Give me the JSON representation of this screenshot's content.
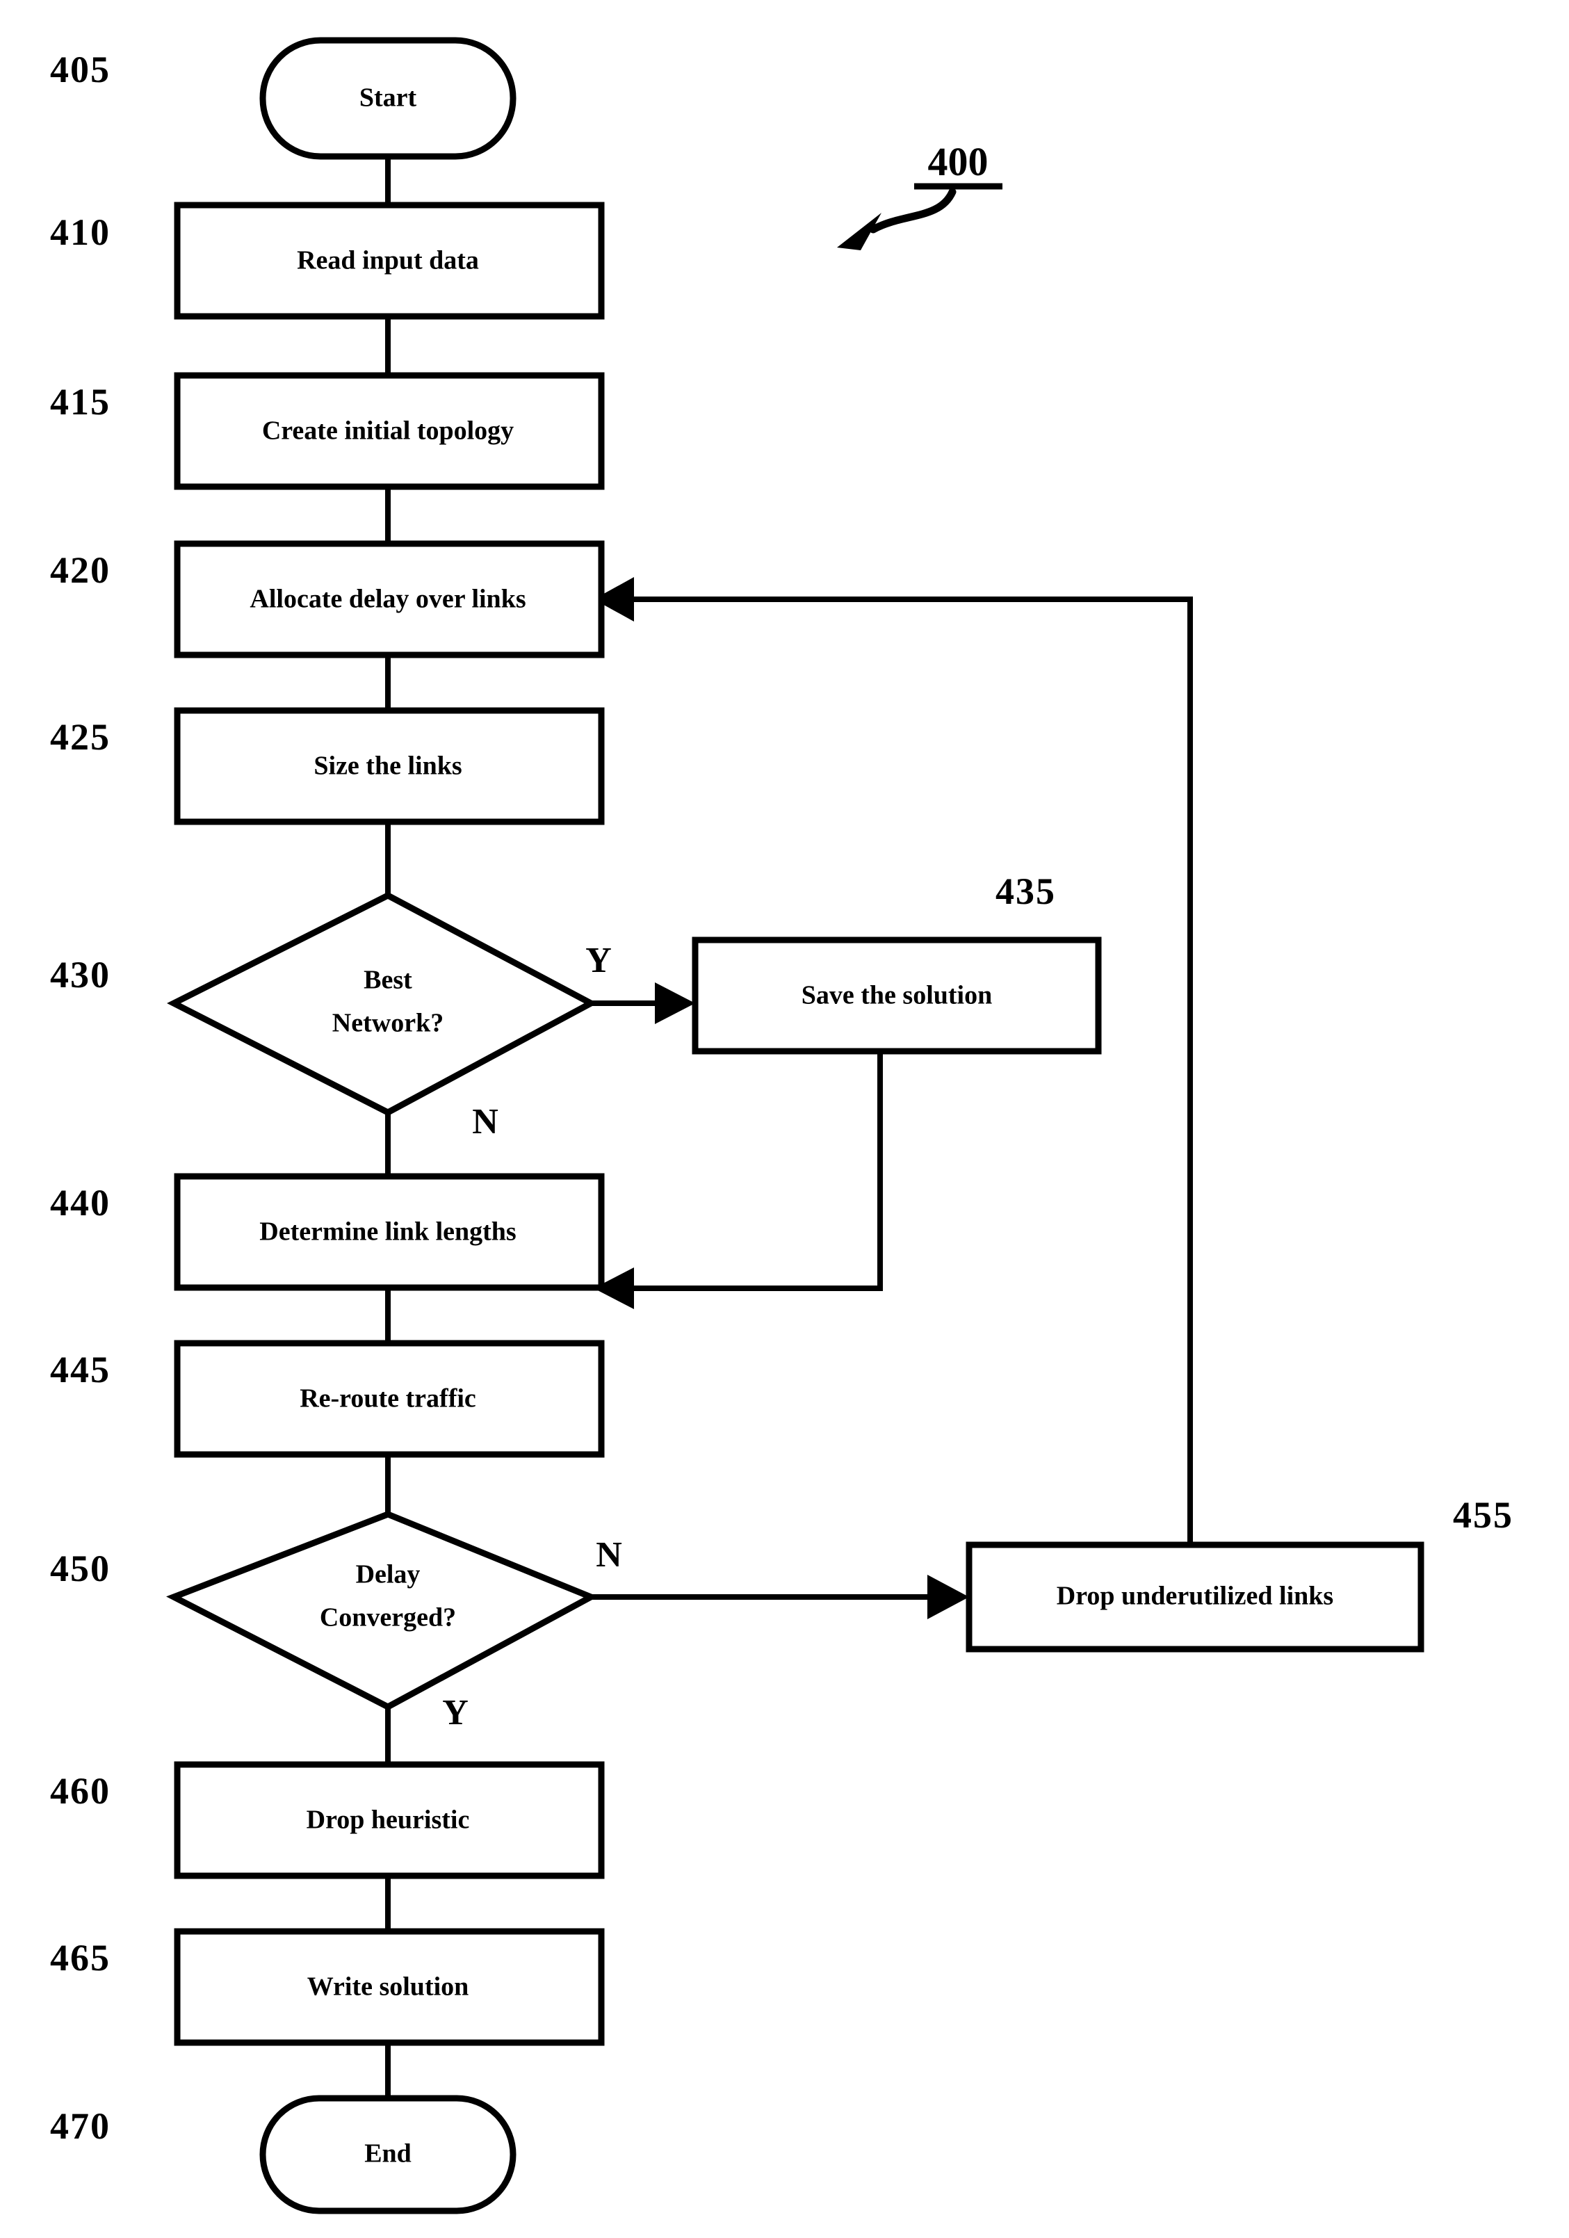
{
  "figure": {
    "number": "400",
    "title_ref": "400"
  },
  "nodes": [
    {
      "id": "start",
      "ref": "405",
      "label": "Start",
      "shape": "terminal"
    },
    {
      "id": "read",
      "ref": "410",
      "label": "Read input data",
      "shape": "process"
    },
    {
      "id": "topo",
      "ref": "415",
      "label": "Create initial topology",
      "shape": "process"
    },
    {
      "id": "alloc",
      "ref": "420",
      "label": "Allocate delay over links",
      "shape": "process"
    },
    {
      "id": "size",
      "ref": "425",
      "label": "Size the links",
      "shape": "process"
    },
    {
      "id": "best",
      "ref": "430",
      "label": "Best Network?",
      "shape": "decision",
      "line1": "Best",
      "line2": "Network?"
    },
    {
      "id": "save",
      "ref": "435",
      "label": "Save the solution",
      "shape": "process"
    },
    {
      "id": "lengths",
      "ref": "440",
      "label": "Determine link lengths",
      "shape": "process"
    },
    {
      "id": "reroute",
      "ref": "445",
      "label": "Re-route traffic",
      "shape": "process"
    },
    {
      "id": "delay",
      "ref": "450",
      "label": "Delay Converged?",
      "shape": "decision",
      "line1": "Delay",
      "line2": "Converged?"
    },
    {
      "id": "drop",
      "ref": "455",
      "label": "Drop underutilized links",
      "shape": "process"
    },
    {
      "id": "heur",
      "ref": "460",
      "label": "Drop heuristic",
      "shape": "process"
    },
    {
      "id": "write",
      "ref": "465",
      "label": "Write solution",
      "shape": "process"
    },
    {
      "id": "end",
      "ref": "470",
      "label": "End",
      "shape": "terminal"
    }
  ],
  "branch_labels": {
    "best_yes": "Y",
    "best_no": "N",
    "delay_no": "N",
    "delay_yes": "Y"
  }
}
